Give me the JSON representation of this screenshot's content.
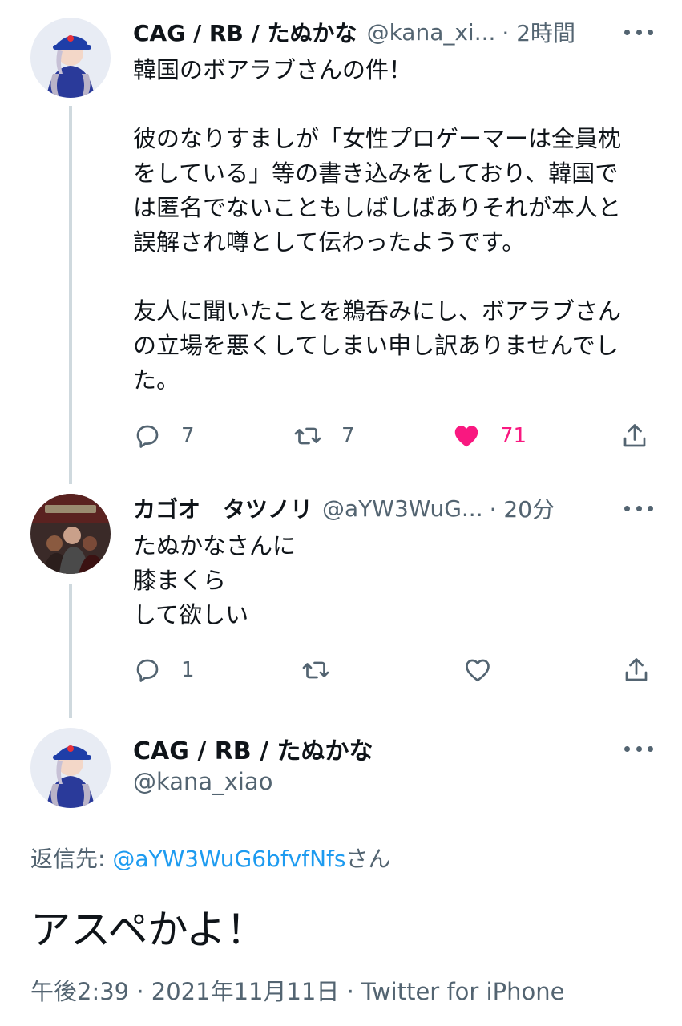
{
  "colors": {
    "text": "#0f1419",
    "secondary": "#536471",
    "link": "#1d9bf0",
    "like": "#f91880",
    "thread_line": "#cfd9de"
  },
  "tweets": [
    {
      "name": "CAG / RB / たぬかな",
      "handle": "@kana_xi...",
      "time": "· 2時間",
      "text": "韓国のボアラブさんの件！\n\n彼のなりすましが「女性プロゲーマーは全員枕\nをしている」等の書き込みをしており、韓国で\nは匿名でないこともしばしばありそれが本人と\n誤解され噂として伝わったようです。\n\n友人に聞いたことを鵜呑みにし、ボアラブさん\nの立場を悪くしてしまい申し訳ありませんでし\nた。",
      "avatar_icon": "user-avatar-icon",
      "actions": {
        "reply_count": "7",
        "retweet_count": "7",
        "like_count": "71",
        "liked": true
      }
    },
    {
      "name": "カゴオ　タツノリ",
      "handle": "@aYW3WuG...",
      "time": "· 20分",
      "text": "たぬかなさんに\n膝まくら\nして欲しい",
      "avatar_icon": "user-avatar-icon",
      "actions": {
        "reply_count": "1",
        "retweet_count": "",
        "like_count": "",
        "liked": false
      }
    }
  ],
  "main_tweet": {
    "name": "CAG / RB / たぬかな",
    "handle": "@kana_xiao",
    "reply_prefix": "返信先: ",
    "reply_link": "@aYW3WuG6bfvfNfs",
    "reply_suffix": "さん",
    "text": "アスペかよ！",
    "meta": "午後2:39 · 2021年11月11日 · Twitter for iPhone"
  }
}
